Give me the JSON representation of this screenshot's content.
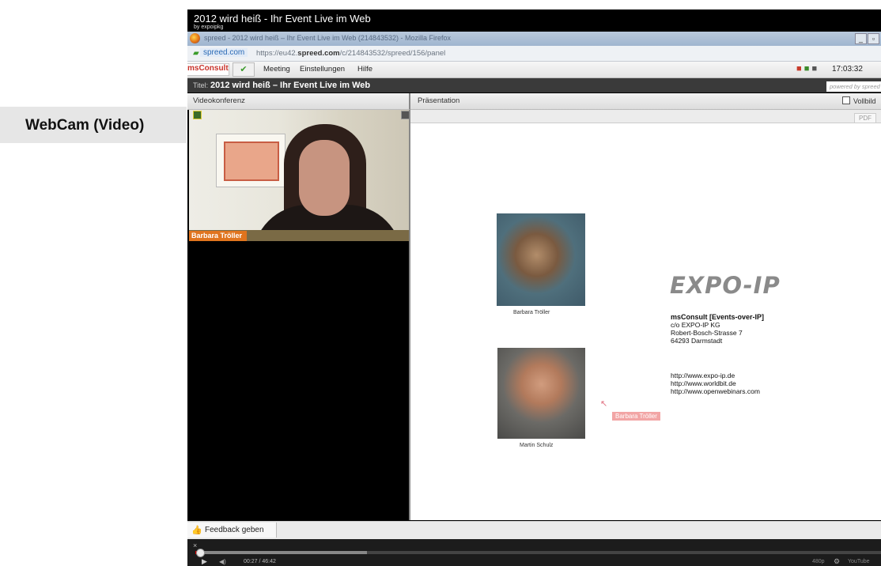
{
  "annotation": {
    "label": "WebCam (Video)",
    "arrow_color": "#8b1a1a"
  },
  "video": {
    "title": "2012 wird heiß - Ihr Event Live im Web",
    "subtitle": "by expoipkg"
  },
  "browser": {
    "window_title": "spreed - 2012 wird heiß – Ihr Event Live im Web (214843532) - Mozilla Firefox",
    "site_badge": "spreed.com",
    "url_prefix": "https://eu42.",
    "url_domain": "spreed.com",
    "url_suffix": "/c/214843532/spreed/156/panel"
  },
  "app": {
    "brand": "msConsult",
    "menu": [
      "Meeting",
      "Einstellungen",
      "Hilfe"
    ],
    "clock": "17:03:32",
    "title_label": "Titel:",
    "title_value": "2012 wird heiß – Ihr Event Live im Web",
    "powered_by": "powered by spreed"
  },
  "videoconference": {
    "header": "Videokonferenz",
    "participant_name": "Barbara Tröller"
  },
  "presentation": {
    "header": "Präsentation",
    "fullscreen_label": "Vollbild",
    "pdf_button": "PDF",
    "slide": {
      "logo_text": "EXPO-IP",
      "photo1_caption": "Barbara Tröller",
      "photo2_caption": "Martin Schulz",
      "company": "msConsult [Events-over-IP]",
      "address_lines": [
        "c/o EXPO-IP KG",
        "Robert-Bosch-Strasse 7",
        "64293 Darmstadt"
      ],
      "links": [
        "http://www.expo-ip.de",
        "http://www.worldbit.de",
        "http://www.openwebinars.com"
      ],
      "pointer_label": "Barbara Tröller"
    }
  },
  "feedback": {
    "label": "Feedback geben"
  },
  "player": {
    "close": "×",
    "time": "00:27 / 46:42",
    "quality": "480p",
    "brand": "YouTube",
    "progress_fraction": 0.006,
    "buffer_fraction": 0.25
  }
}
